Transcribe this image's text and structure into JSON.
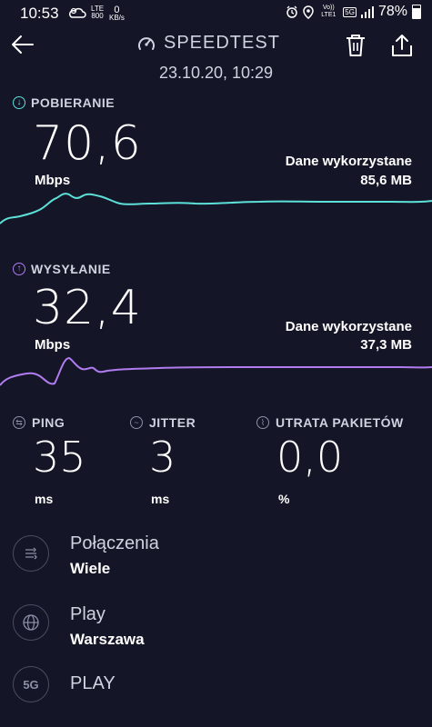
{
  "status_bar": {
    "time": "10:53",
    "network_label": "LTE",
    "network_speed": "800",
    "data_rate_value": "0",
    "data_rate_unit": "KB/s",
    "volte_label": "Vo)) LTE1",
    "badge_5g": "5G",
    "battery_text": "78%",
    "battery_level": 0.78
  },
  "header": {
    "title": "SPEEDTEST",
    "date": "23.10.20, 10:29"
  },
  "download": {
    "label": "POBIERANIE",
    "value": "70,6",
    "unit": "Mbps",
    "data_used_label": "Dane wykorzystane",
    "data_used_value": "85,6 MB",
    "color": "#5ce0d8"
  },
  "upload": {
    "label": "WYSYŁANIE",
    "value": "32,4",
    "unit": "Mbps",
    "data_used_label": "Dane wykorzystane",
    "data_used_value": "37,3 MB",
    "color": "#b07cf0"
  },
  "metrics": {
    "ping": {
      "label": "PING",
      "value": "35",
      "unit": "ms"
    },
    "jitter": {
      "label": "JITTER",
      "value": "3",
      "unit": "ms"
    },
    "packet_loss": {
      "label": "UTRATA PAKIETÓW",
      "value": "0,0",
      "unit": "%"
    }
  },
  "info": {
    "connections": {
      "title": "Połączenia",
      "value": "Wiele",
      "icon": "connections-icon"
    },
    "server": {
      "title": "Play",
      "value": "Warszawa",
      "icon": "globe-icon"
    },
    "provider": {
      "badge": "5G",
      "title": "PLAY",
      "icon": "5g-icon"
    }
  }
}
